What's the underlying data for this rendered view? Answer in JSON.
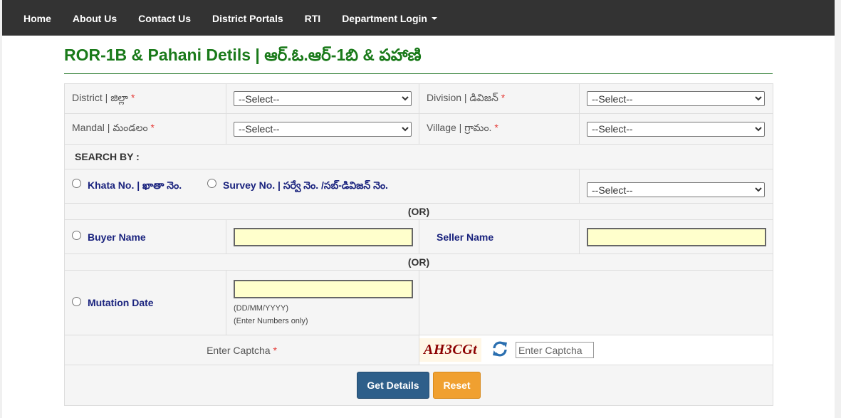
{
  "nav": {
    "items": [
      "Home",
      "About Us",
      "Contact Us",
      "District Portals",
      "RTI",
      "Department Login"
    ]
  },
  "page": {
    "title": "ROR-1B & Pahani Detils | ఆర్.ఓ.ఆర్-1బి & పహాణి"
  },
  "form": {
    "district_label": "District | జిల్లా ",
    "division_label": "Division | డివిజన్ ",
    "mandal_label": "Mandal | మండలం ",
    "village_label": "Village | గ్రామం. ",
    "required_mark": "*",
    "select_placeholder": "--Select--",
    "search_by": "SEARCH BY :",
    "khata_label": "Khata No. | ఖాతా నెం.",
    "survey_label": "Survey No. | సర్వే నెం. /సబ్-డివిజన్ నెం.",
    "or_text": "(OR)",
    "buyer_label": "Buyer Name",
    "seller_label": "Seller Name",
    "mutation_label": "Mutation Date",
    "date_hint": "(DD/MM/YYYY)",
    "numbers_hint": "(Enter Numbers only)",
    "captcha_label": "Enter Captcha ",
    "captcha_code": "AH3CGt",
    "captcha_placeholder": "Enter Captcha",
    "get_details": "Get Details",
    "reset": "Reset"
  },
  "colors": {
    "navbar": "#333333",
    "title": "#1a7a1a",
    "required": "#e53935",
    "label_blue": "#1a237e",
    "input_yellow": "#ffffcc",
    "primary_button": "#2e5f8a",
    "warning_button": "#f0a030"
  },
  "icons": [
    "caret-down-icon",
    "refresh-icon"
  ]
}
